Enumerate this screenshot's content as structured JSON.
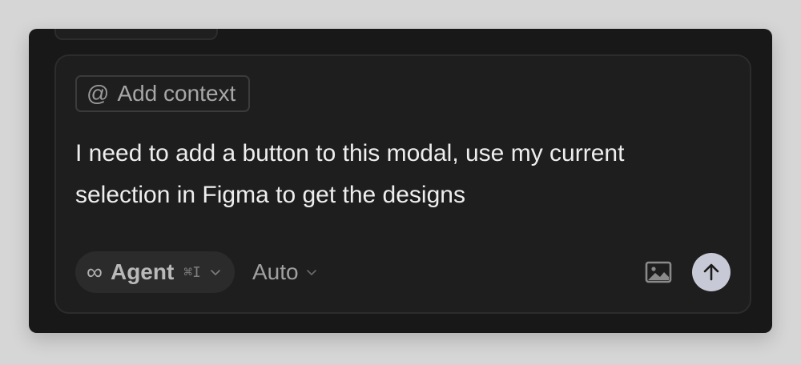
{
  "composer": {
    "context_chip": {
      "icon": "at-icon",
      "at_symbol": "@",
      "label": "Add context"
    },
    "prompt": "I need to add a button to this modal, use my current selection in Figma to get the designs",
    "mode": {
      "icon": "infinity-icon",
      "infinity_symbol": "∞",
      "label": "Agent",
      "shortcut": "⌘I"
    },
    "model": {
      "label": "Auto"
    },
    "image_button": {
      "icon": "image-icon"
    },
    "send_button": {
      "icon": "arrow-up-icon",
      "color": "#c7c9d6"
    }
  }
}
